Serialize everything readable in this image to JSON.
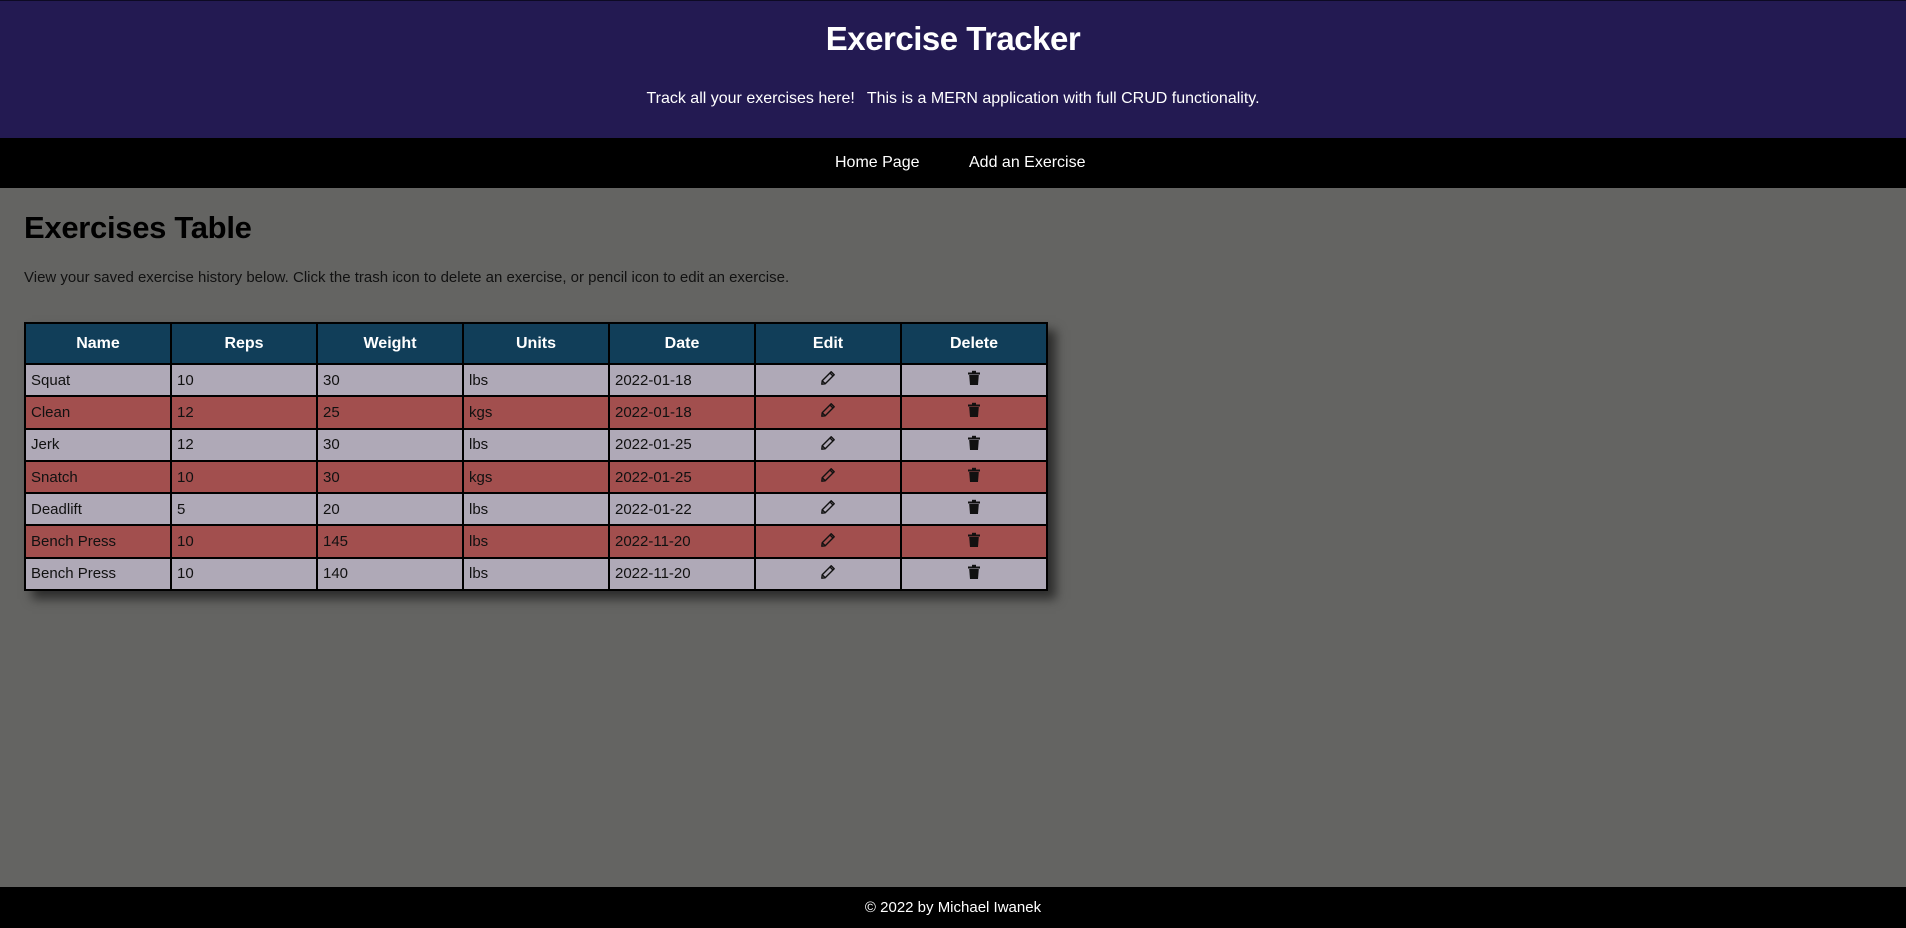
{
  "header": {
    "title": "Exercise Tracker",
    "tagline_part1": "Track all your exercises here!",
    "tagline_part2": "This is a MERN application with full CRUD functionality."
  },
  "nav": {
    "items": [
      {
        "label": "Home Page"
      },
      {
        "label": "Add an Exercise"
      }
    ]
  },
  "main": {
    "title": "Exercises Table",
    "description": "View your saved exercise history below. Click the trash icon to delete an exercise, or pencil icon to edit an exercise."
  },
  "table": {
    "columns": [
      "Name",
      "Reps",
      "Weight",
      "Units",
      "Date",
      "Edit",
      "Delete"
    ],
    "rows": [
      {
        "name": "Squat",
        "reps": "10",
        "weight": "30",
        "unit": "lbs",
        "date": "2022-01-18"
      },
      {
        "name": "Clean",
        "reps": "12",
        "weight": "25",
        "unit": "kgs",
        "date": "2022-01-18"
      },
      {
        "name": "Jerk",
        "reps": "12",
        "weight": "30",
        "unit": "lbs",
        "date": "2022-01-25"
      },
      {
        "name": "Snatch",
        "reps": "10",
        "weight": "30",
        "unit": "kgs",
        "date": "2022-01-25"
      },
      {
        "name": "Deadlift",
        "reps": "5",
        "weight": "20",
        "unit": "lbs",
        "date": "2022-01-22"
      },
      {
        "name": "Bench Press",
        "reps": "10",
        "weight": "145",
        "unit": "lbs",
        "date": "2022-11-20"
      },
      {
        "name": "Bench Press",
        "reps": "10",
        "weight": "140",
        "unit": "lbs",
        "date": "2022-11-20"
      }
    ],
    "edit_icon": "pencil-icon",
    "delete_icon": "trash-icon"
  },
  "footer": {
    "text": "© 2022 by Michael Iwanek"
  },
  "colors": {
    "header_bg": "#231a52",
    "nav_bg": "#000000",
    "page_bg": "#646462",
    "table_header_bg": "#113e59",
    "row_light": "#afa9b7",
    "row_dark": "#a24f4e",
    "footer_bg": "#000000"
  }
}
